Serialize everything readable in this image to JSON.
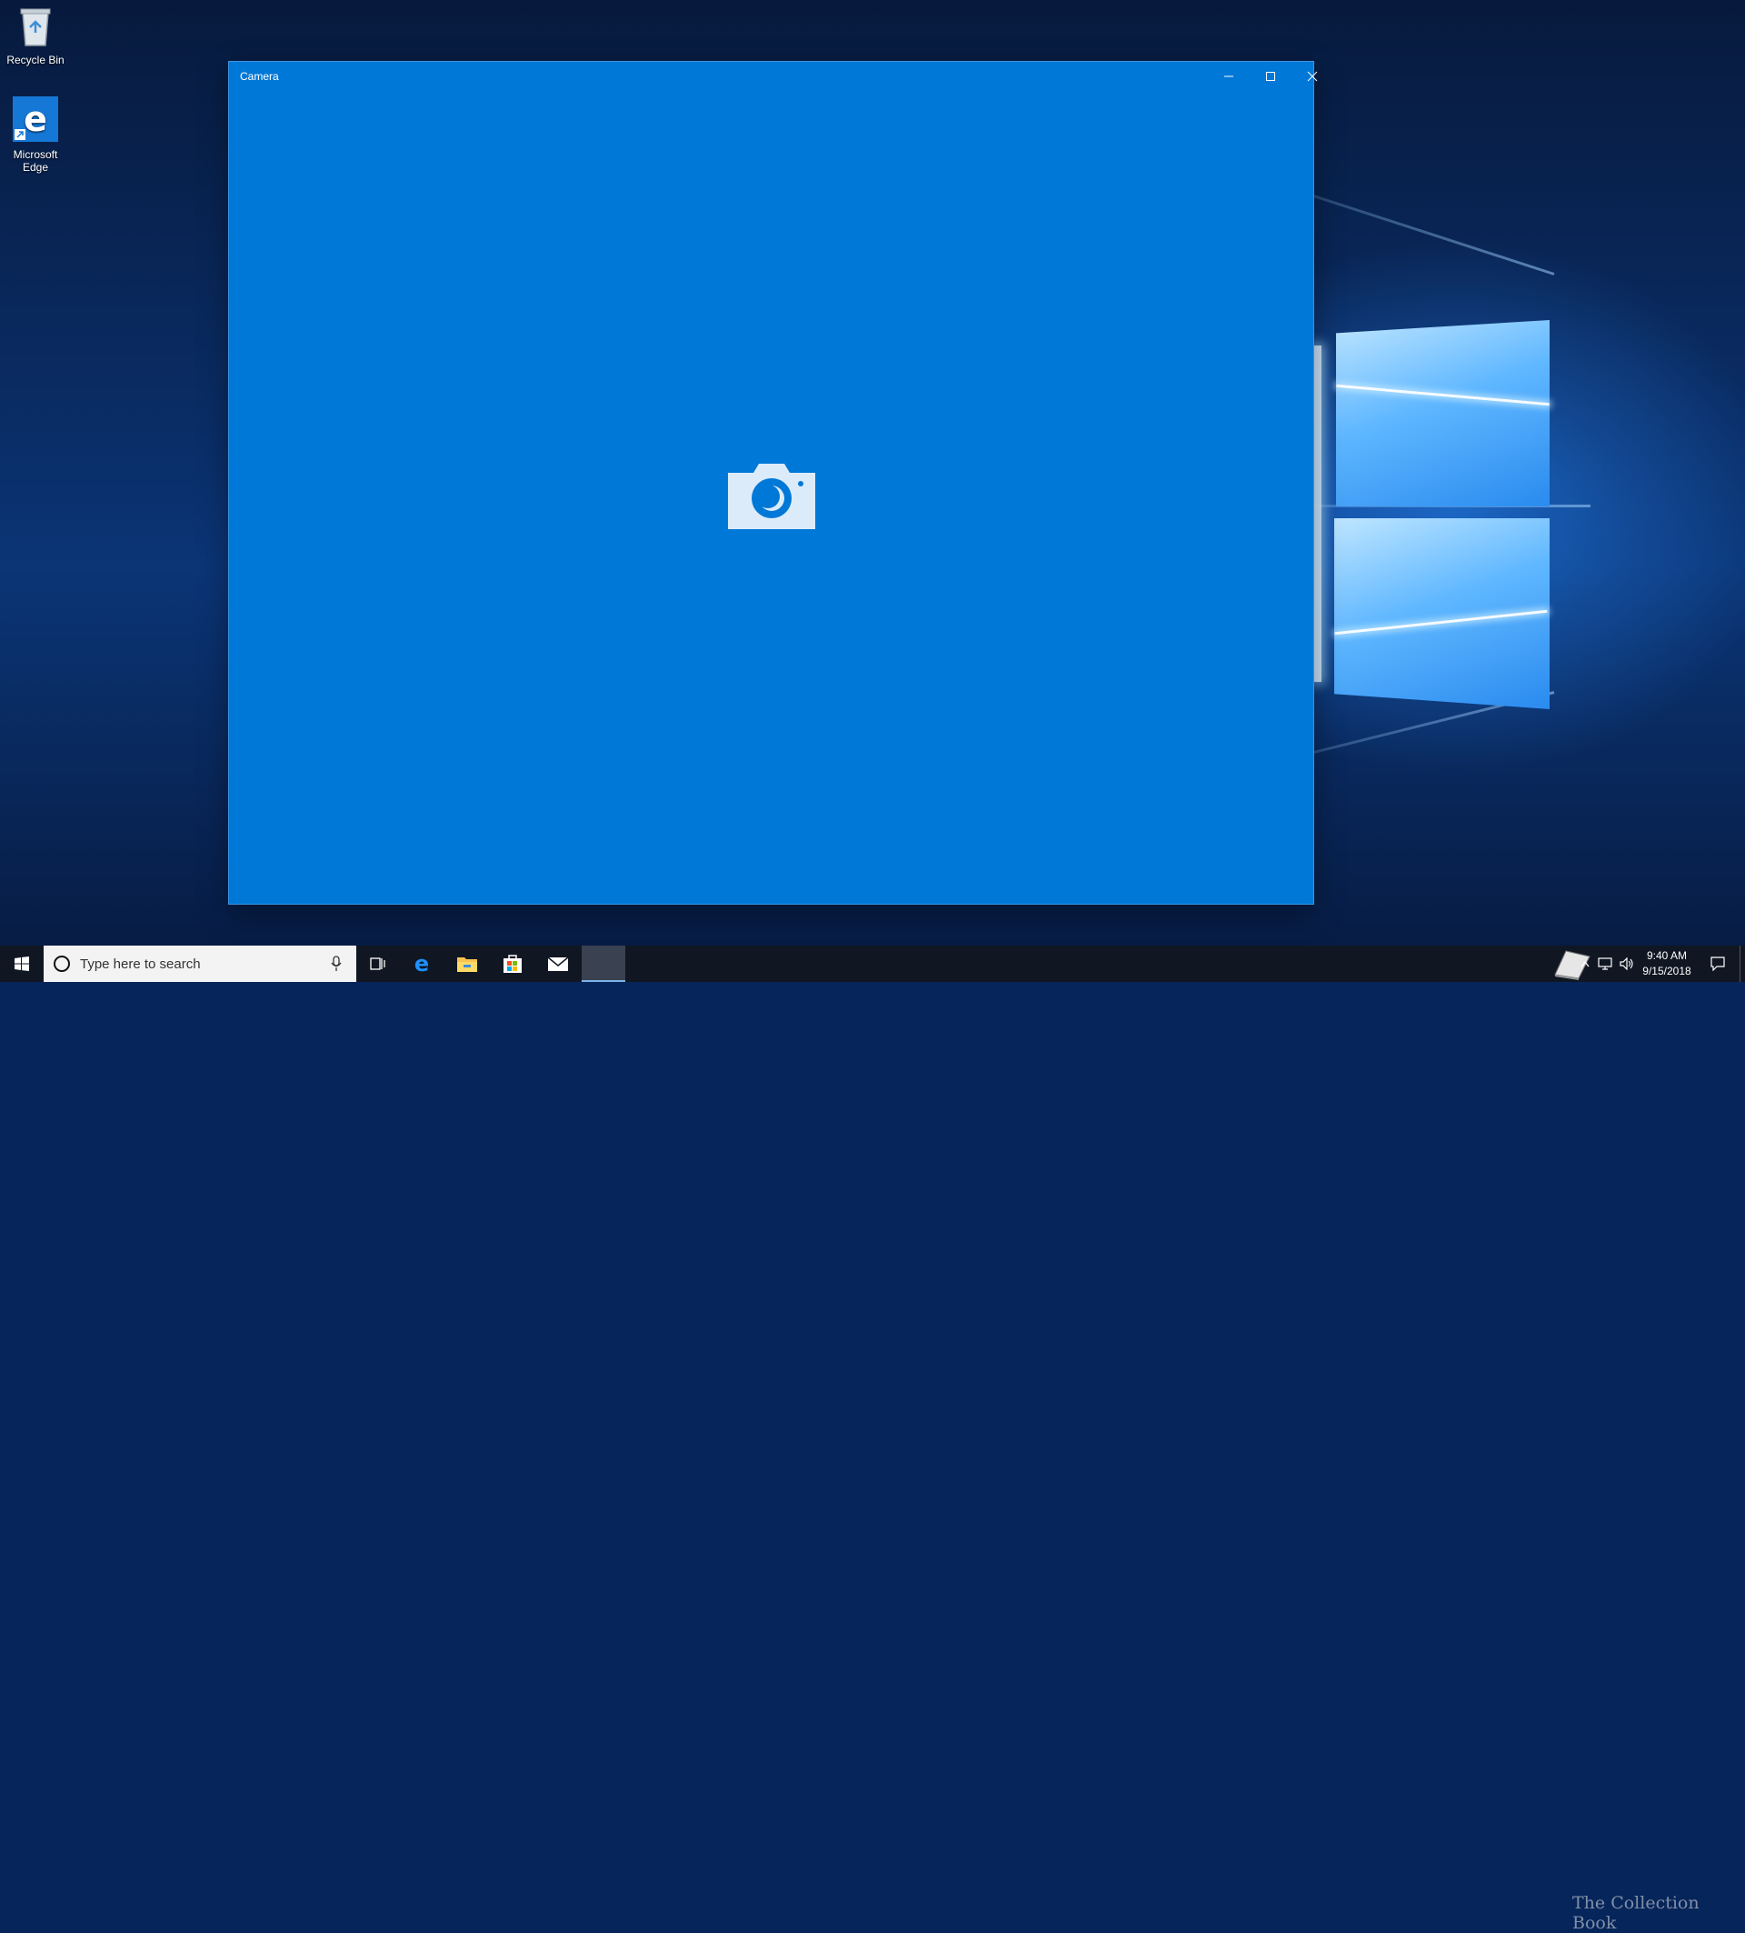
{
  "desktop": {
    "icons": [
      {
        "label": "Recycle Bin",
        "icon": "recycle-bin-icon"
      },
      {
        "label": "Microsoft Edge",
        "icon": "edge-icon"
      }
    ]
  },
  "window": {
    "title": "Camera",
    "background_color": "#0078d7",
    "center_icon": "camera-icon",
    "controls": [
      "minimize-icon",
      "maximize-icon",
      "close-icon"
    ]
  },
  "taskbar": {
    "start_icon": "windows-logo-icon",
    "search": {
      "placeholder": "Type here to search"
    },
    "pinned": [
      "task-view-icon",
      "edge-icon",
      "file-explorer-icon",
      "store-icon",
      "mail-icon",
      "active-app"
    ],
    "tray": {
      "time": "9:40 AM",
      "date": "9/15/2018"
    }
  },
  "watermark": "The Collection Book"
}
